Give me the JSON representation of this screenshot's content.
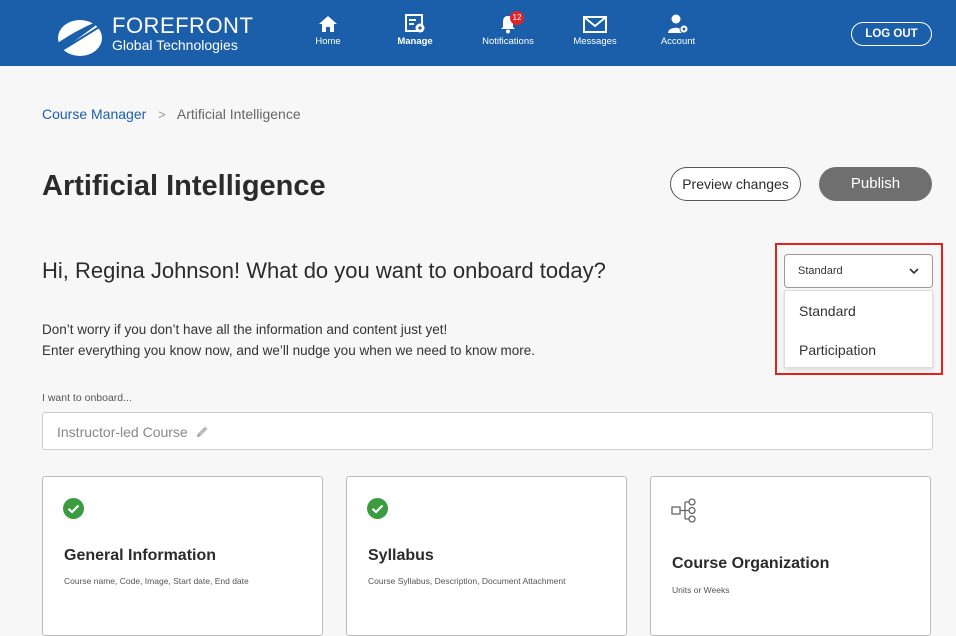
{
  "brand": {
    "name": "FOREFRONT",
    "tagline": "Global Technologies",
    "color": "#1b5fab"
  },
  "nav": {
    "items": [
      {
        "label": "Home",
        "icon": "home-icon"
      },
      {
        "label": "Manage",
        "icon": "manage-icon",
        "active": true
      },
      {
        "label": "Notifications",
        "icon": "bell-icon",
        "badge": "12"
      },
      {
        "label": "Messages",
        "icon": "envelope-icon"
      },
      {
        "label": "Account",
        "icon": "account-icon"
      }
    ],
    "logout_label": "LOG OUT"
  },
  "breadcrumb": {
    "parent": "Course Manager",
    "separator": ">",
    "current": "Artificial Intelligence"
  },
  "page": {
    "title": "Artificial Intelligence",
    "preview_label": "Preview changes",
    "publish_label": "Publish",
    "greeting": "Hi, Regina Johnson! What do you want to onboard today?",
    "intro_line1": "Don’t worry if you don’t have all the information and content just yet!",
    "intro_line2": "Enter everything you know now, and we’ll nudge you when we need to know more."
  },
  "type_dropdown": {
    "selected": "Standard",
    "options": [
      "Standard",
      "Participation"
    ],
    "highlight_color": "#e1231e"
  },
  "onboard": {
    "label": "I want to onboard...",
    "value": "Instructor-led Course"
  },
  "cards": [
    {
      "title": "General Information",
      "subtitle": "Course name, Code, Image, Start date, End date",
      "status": "complete",
      "icon": "check-circle-icon"
    },
    {
      "title": "Syllabus",
      "subtitle": "Course Syllabus, Description, Document Attachment",
      "status": "complete",
      "icon": "check-circle-icon"
    },
    {
      "title": "Course Organization",
      "subtitle": "Units or Weeks",
      "status": "incomplete",
      "icon": "hierarchy-icon"
    }
  ],
  "colors": {
    "success": "#3b9b3f",
    "publish_bg": "#6f6f6f"
  }
}
